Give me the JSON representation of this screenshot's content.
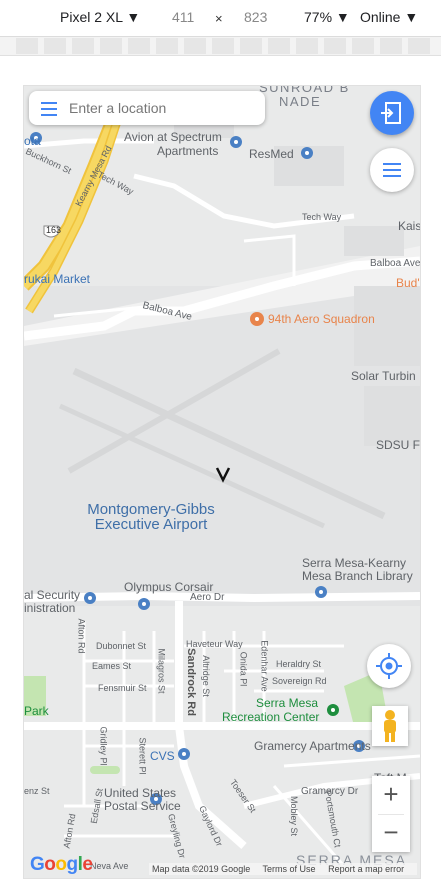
{
  "devtools": {
    "device": "Pixel 2 XL ▼",
    "width": "411",
    "times": "×",
    "height": "823",
    "zoom": "77% ▼",
    "network": "Online ▼"
  },
  "search": {
    "placeholder": "Enter a location"
  },
  "map": {
    "labels": {
      "sunroad": "SUNROAD B",
      "nade": "NADE",
      "avion1": "Avion at Spectrum",
      "avion2": "Apartments",
      "resmed": "ResMed",
      "ota": "ota",
      "kearny_mesa_rd": "Kearny Mesa Rd",
      "buckhorn": "Buckhorn St",
      "tech_way": "Tech Way",
      "tech_way2": "Tech Way",
      "kais": "Kais",
      "route": "163",
      "rukai": "rukai Market",
      "balboa_ave_right": "Balboa Ave",
      "budl": "Bud'l",
      "balboa_ave": "Balboa Ave",
      "aero_squadron": "94th Aero Squadron",
      "solar_turbin": "Solar Turbin",
      "sdsu": "SDSU Fo",
      "airport1": "Montgomery-Gibbs",
      "airport2": "Executive Airport",
      "library1": "Serra Mesa-Kearny",
      "library2": "Mesa Branch Library",
      "social1": "al Security",
      "social2": "inistration",
      "olympus": "Olympus Corsair",
      "aero_dr": "Aero Dr",
      "afton": "Afton Rd",
      "dubonnet": "Dubonnet St",
      "haveteur": "Haveteur Way",
      "heraldry": "Heraldry St",
      "eames": "Eames St",
      "milagros": "Milagros St",
      "altridge": "Altridge St",
      "onida": "Onida Pl",
      "sovereign": "Sovereign Rd",
      "edenhar": "Edenhar Ave",
      "fensmuir": "Fensmuir St",
      "sandrock": "Sandrock Rd",
      "park": "Park",
      "rec1": "Serra Mesa",
      "rec2": "Recreation Center",
      "gramercy_apts": "Gramercy Apartments",
      "gridley": "Gridley Pl",
      "sterett": "Sterett Pl",
      "cvs": "CVS",
      "taft": "Taft M",
      "post1": "United States",
      "post2": "Postal Service",
      "gramercy_dr": "Gramercy Dr",
      "enz": "enz St",
      "edsall": "Edsall St",
      "afton_rd2": "Afton Rd",
      "gaylord": "Gaylord Dr",
      "greyling": "Greyling Dr",
      "toeser": "Toeser St",
      "mobley": "Mobley St",
      "portsmouth": "Portsmouth Ct",
      "serra_mesa": "SERRA MESA",
      "neva": "Neva Ave"
    }
  },
  "footer": {
    "google": "Google",
    "map_data": "Map data ©2019 Google",
    "terms": "Terms of Use",
    "report": "Report a map error"
  },
  "controls": {
    "zoom_in": "+",
    "zoom_out": "−"
  },
  "colors": {
    "accent": "#4285f4",
    "highway": "#f7d862",
    "park": "#c4e5b1",
    "airport_text": "#3f6fa8"
  }
}
